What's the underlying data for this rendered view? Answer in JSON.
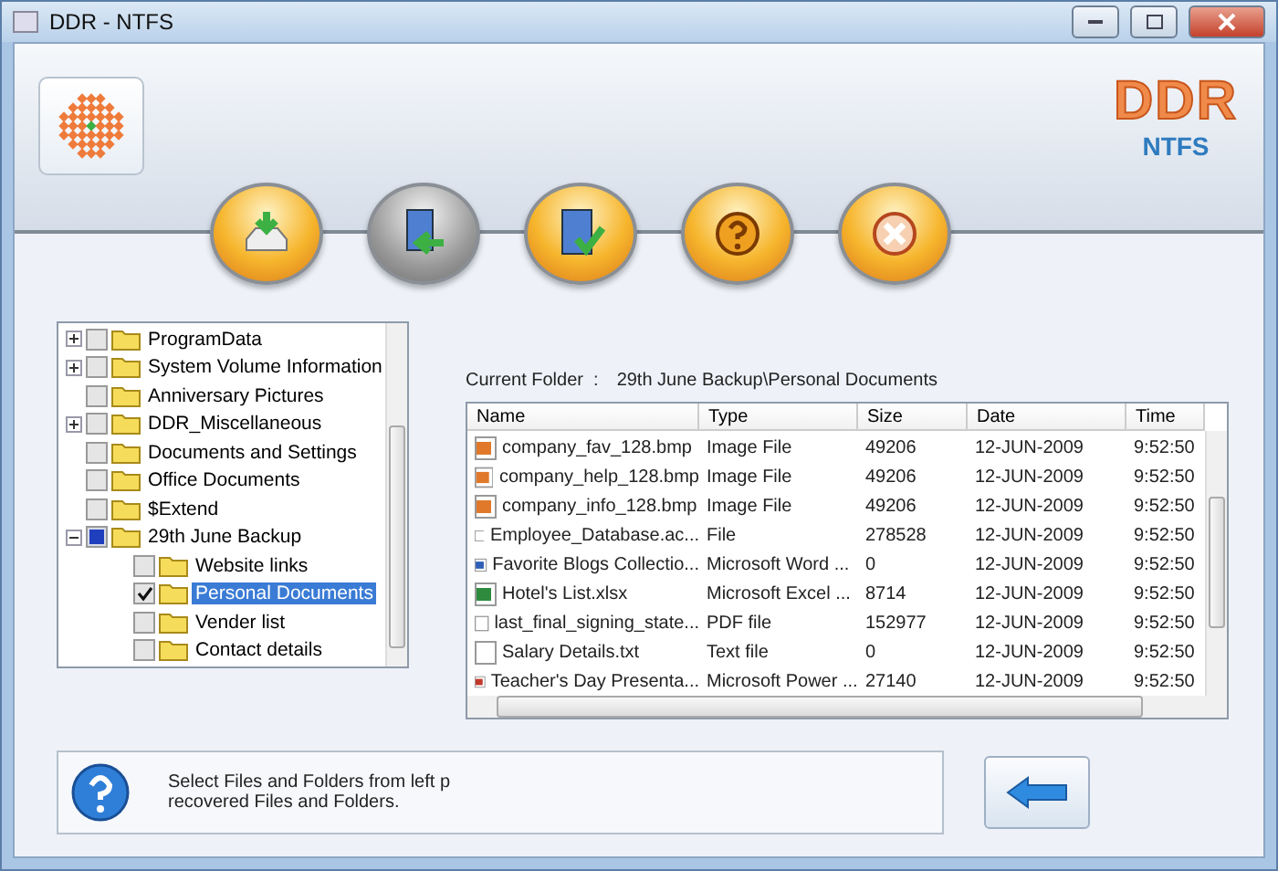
{
  "window": {
    "title": "DDR - NTFS"
  },
  "logo": {
    "title": "DDR",
    "subtitle": "NTFS"
  },
  "toolbar": [
    {
      "kind": "recover"
    },
    {
      "kind": "export"
    },
    {
      "kind": "save"
    },
    {
      "kind": "help"
    },
    {
      "kind": "exit"
    }
  ],
  "tree": [
    {
      "label": "ProgramData",
      "expanded": false,
      "checked": false,
      "partial": false,
      "selected": false
    },
    {
      "label": "System Volume Information",
      "expanded": false,
      "checked": false,
      "partial": false,
      "selected": false
    },
    {
      "label": "Anniversary Pictures",
      "checked": false,
      "partial": false,
      "selected": false
    },
    {
      "label": "DDR_Miscellaneous",
      "expanded": false,
      "checked": false,
      "partial": false,
      "selected": false
    },
    {
      "label": "Documents and Settings",
      "checked": false,
      "partial": false,
      "selected": false
    },
    {
      "label": "Office Documents",
      "checked": false,
      "partial": false,
      "selected": false
    },
    {
      "label": "$Extend",
      "checked": false,
      "partial": false,
      "selected": false
    },
    {
      "label": "29th June Backup",
      "expanded": true,
      "checked": false,
      "partial": true,
      "selected": false,
      "children": [
        {
          "label": "Website links",
          "checked": false,
          "partial": false,
          "selected": false
        },
        {
          "label": "Personal Documents",
          "checked": true,
          "partial": false,
          "selected": true
        },
        {
          "label": "Vender list",
          "checked": false,
          "partial": false,
          "selected": false
        },
        {
          "label": "Contact details",
          "checked": false,
          "partial": false,
          "selected": false
        }
      ]
    }
  ],
  "current_folder": {
    "label": "Current Folder  :",
    "value": "29th June Backup\\Personal Documents"
  },
  "table": {
    "columns": [
      "Name",
      "Type",
      "Size",
      "Date",
      "Time"
    ],
    "rows": [
      {
        "kind": "image",
        "cells": [
          "company_fav_128.bmp",
          "Image File",
          "49206",
          "12-JUN-2009",
          "9:52:50"
        ]
      },
      {
        "kind": "image",
        "cells": [
          "company_help_128.bmp",
          "Image File",
          "49206",
          "12-JUN-2009",
          "9:52:50"
        ]
      },
      {
        "kind": "image",
        "cells": [
          "company_info_128.bmp",
          "Image File",
          "49206",
          "12-JUN-2009",
          "9:52:50"
        ]
      },
      {
        "kind": "blank",
        "cells": [
          "Employee_Database.ac...",
          "File",
          "278528",
          "12-JUN-2009",
          "9:52:50"
        ]
      },
      {
        "kind": "word",
        "cells": [
          "Favorite Blogs Collectio...",
          "Microsoft Word ...",
          "0",
          "12-JUN-2009",
          "9:52:50"
        ]
      },
      {
        "kind": "excel",
        "cells": [
          "Hotel's List.xlsx",
          "Microsoft Excel ...",
          "8714",
          "12-JUN-2009",
          "9:52:50"
        ]
      },
      {
        "kind": "blank",
        "cells": [
          "last_final_signing_state...",
          "PDF file",
          "152977",
          "12-JUN-2009",
          "9:52:50"
        ]
      },
      {
        "kind": "blank",
        "cells": [
          "Salary Details.txt",
          "Text file",
          "0",
          "12-JUN-2009",
          "9:52:50"
        ]
      },
      {
        "kind": "powerpoint",
        "cells": [
          "Teacher's Day Presenta...",
          "Microsoft Power ...",
          "27140",
          "12-JUN-2009",
          "9:52:50"
        ]
      }
    ]
  },
  "info": {
    "lines": [
      "Select Files and Folders from left p",
      "recovered Files and Folders."
    ]
  },
  "back_button": {
    "kind": "back"
  }
}
